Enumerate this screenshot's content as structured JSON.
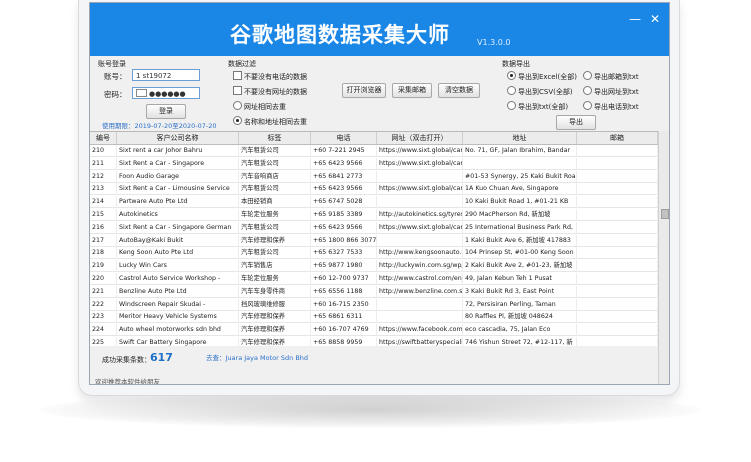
{
  "app": {
    "title": "谷歌地图数据采集大师",
    "version": "V1.3.0.0"
  },
  "window_controls": {
    "minimize": "—",
    "close": "✕"
  },
  "login": {
    "section": "账号登录",
    "account_label": "账号：",
    "account_value": "1      st19072",
    "password_label": "密码：",
    "password_value": "●●●●●●",
    "login_button": "登录",
    "usage_period": "使用期限：2019-07-20至2020-07-20"
  },
  "filter": {
    "section": "数据过滤",
    "options": [
      "不要没有电话的数据",
      "不要没有网址的数据",
      "网址相同去重",
      "名称和地址相同去重"
    ],
    "checked_radio": 3
  },
  "actions": {
    "open_browser": "打开浏览器",
    "collect_email": "采集邮箱",
    "clear_data": "清空数据"
  },
  "export": {
    "section": "数据导出",
    "options": [
      "导出到Excel(全部)",
      "导出邮箱到txt",
      "导出到CSV(全部)",
      "导出网址到txt",
      "导出到txt(全部)",
      "导出电话到txt"
    ],
    "selected": 0,
    "button": "导出"
  },
  "table": {
    "columns": [
      "编号",
      "客户公司名称",
      "标签",
      "电话",
      "网址（双击打开）",
      "地址",
      "邮箱"
    ],
    "rows": [
      [
        "210",
        "Sixt rent a car Johor Bahru",
        "汽车租赁公司",
        "+60 7-221 2945",
        "https://www.sixt.global/car-r",
        "No. 71, GF, Jalan Ibrahim, Bandar",
        ""
      ],
      [
        "211",
        "Sixt Rent a Car - Singapore",
        "汽车租赁公司",
        "+65 6423 9566",
        "https://www.sixt.global/car-r",
        "",
        ""
      ],
      [
        "212",
        "Foon Audio Garage",
        "汽车音响商店",
        "+65 6841 2773",
        "",
        "#01-53 Synergy, 25 Kaki Bukit Road",
        ""
      ],
      [
        "213",
        "Sixt Rent a Car - Limousine Service",
        "汽车租赁公司",
        "+65 6423 9566",
        "https://www.sixt.global/car-r",
        "1A Kuo Chuan Ave, Singapore",
        ""
      ],
      [
        "214",
        "Partware Auto Pte Ltd",
        "本田经销商",
        "+65 6747 5028",
        "",
        "10 Kaki Bukit Road 1, #01-21 KB",
        ""
      ],
      [
        "215",
        "Autokinetics",
        "车轮定位服务",
        "+65 9185 3389",
        "http://autokinetics.sg/tyresh",
        "290 MacPherson Rd, 新加坡",
        ""
      ],
      [
        "216",
        "Sixt Rent a Car - Singapore German",
        "汽车租赁公司",
        "+65 6423 9566",
        "https://www.sixt.global/car-r",
        "25 International Business Park Rd,",
        ""
      ],
      [
        "217",
        "AutoBay@Kaki Bukit",
        "汽车修理和保养",
        "+65 1800 866 3077",
        "",
        "1 Kaki Bukit Ave 6, 新加坡 417883",
        ""
      ],
      [
        "218",
        "Keng Soon Auto Pte Ltd",
        "汽车租赁公司",
        "+65 6327 7533",
        "http://www.kengsoonauto.co",
        "104 Prinsep St, #01-00 Keng Soon",
        ""
      ],
      [
        "219",
        "Lucky Win Cars",
        "汽车销售店",
        "+65 9877 1980",
        "http://luckywin.com.sg/wp/",
        "2 Kaki Bukit Ave 2, #01-23, 新加坡",
        ""
      ],
      [
        "220",
        "Castrol Auto Service Workshop -",
        "车轮定位服务",
        "+60 12-700 9737",
        "http://www.castrol.com/en_",
        "49, Jalan Kebun Teh 1 Pusat",
        ""
      ],
      [
        "221",
        "Benzline Auto Pte Ltd",
        "汽车车身零件商",
        "+65 6556 1188",
        "http://www.benzline.com.sg/",
        "3 Kaki Bukit Rd 3, East Point",
        ""
      ],
      [
        "222",
        "Windscreen Repair Skudai -",
        "挡风玻璃维修服",
        "+60 16-715 2350",
        "",
        "72, Persisiran Perling, Taman",
        ""
      ],
      [
        "223",
        "Meritor Heavy Vehicle Systems",
        "汽车修理和保养",
        "+65 6861 6311",
        "",
        "80 Raffles Pl, 新加坡 048624",
        ""
      ],
      [
        "224",
        "Auto wheel motorworks sdn bhd",
        "汽车修理和保养",
        "+60 16-707 4769",
        "https://www.facebook.com/A",
        "eco cascadia, 75, Jalan Eco",
        ""
      ],
      [
        "225",
        "Swift Car Battery Singapore",
        "汽车修理和保养",
        "+65 8858 9959",
        "https://swiftbatteryspecialist.",
        "746 Yishun Street 72, #12-117, 新",
        ""
      ]
    ]
  },
  "status": {
    "success_label": "成功采集条数：",
    "success_count": "617",
    "goto_prefix": "去查：",
    "goto_name": "Juara Jaya Motor Sdn Bhd",
    "welcome": "欢迎推荐本软件给朋友"
  }
}
